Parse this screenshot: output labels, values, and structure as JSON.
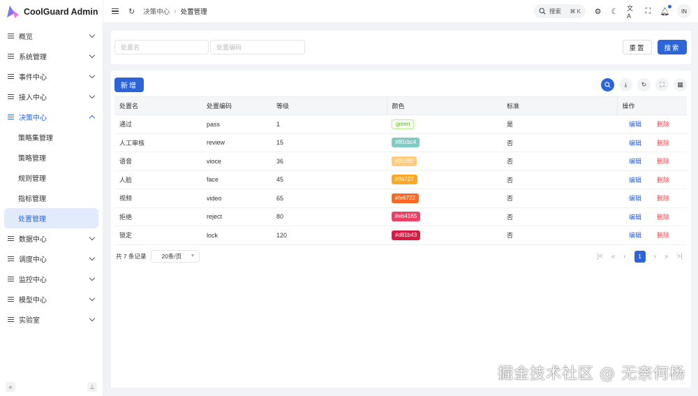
{
  "app": {
    "title": "CoolGuard Admin"
  },
  "sidebar": {
    "items_top": [
      {
        "label": "概览"
      },
      {
        "label": "系统管理"
      },
      {
        "label": "事件中心"
      },
      {
        "label": "接入中心"
      }
    ],
    "open_item": {
      "label": "决策中心"
    },
    "sub_items": [
      {
        "label": "策略集管理"
      },
      {
        "label": "策略管理"
      },
      {
        "label": "规则管理"
      },
      {
        "label": "指标管理"
      },
      {
        "label": "处置管理",
        "active": true
      }
    ],
    "items_bottom": [
      {
        "label": "数据中心"
      },
      {
        "label": "调度中心"
      },
      {
        "label": "监控中心"
      },
      {
        "label": "模型中心"
      },
      {
        "label": "实验室"
      }
    ]
  },
  "header": {
    "breadcrumb": [
      "决策中心",
      "处置管理"
    ],
    "search_label": "搜索",
    "search_shortcut": "⌘ K",
    "avatar": "IN"
  },
  "filters": {
    "name_placeholder": "处置名",
    "code_placeholder": "处置编码",
    "reset_label": "重置",
    "search_label": "搜索"
  },
  "table": {
    "add_label": "新增",
    "columns": [
      "处置名",
      "处置编码",
      "等级",
      "颜色",
      "标准",
      "操作"
    ],
    "rows": [
      {
        "name": "通过",
        "code": "pass",
        "level": "1",
        "color": "green",
        "color_hex": "",
        "standard": "是"
      },
      {
        "name": "人工审核",
        "code": "review",
        "level": "15",
        "color": "#80cbc4",
        "color_hex": "#80cbc4",
        "standard": "否"
      },
      {
        "name": "语音",
        "code": "vioce",
        "level": "36",
        "color": "#ffcc80",
        "color_hex": "#ffcc80",
        "standard": "否"
      },
      {
        "name": "人脸",
        "code": "face",
        "level": "45",
        "color": "#ffa727",
        "color_hex": "#ffa727",
        "standard": "否"
      },
      {
        "name": "视频",
        "code": "video",
        "level": "65",
        "color": "#fe6722",
        "color_hex": "#fe6722",
        "standard": "否"
      },
      {
        "name": "拒绝",
        "code": "reject",
        "level": "80",
        "color": "#eb4165",
        "color_hex": "#eb4165",
        "standard": "否"
      },
      {
        "name": "锁定",
        "code": "lock",
        "level": "120",
        "color": "#d81b43",
        "color_hex": "#d81b43",
        "standard": "否"
      }
    ],
    "edit_label": "编辑",
    "delete_label": "删除"
  },
  "pagination": {
    "total_text": "共 7 条记录",
    "page_size": "20条/页",
    "current_page": "1"
  },
  "watermark": "掘金技术社区 @ 无奈何杨",
  "colors": {
    "primary": "#2b65d9",
    "danger": "#e5484d"
  }
}
